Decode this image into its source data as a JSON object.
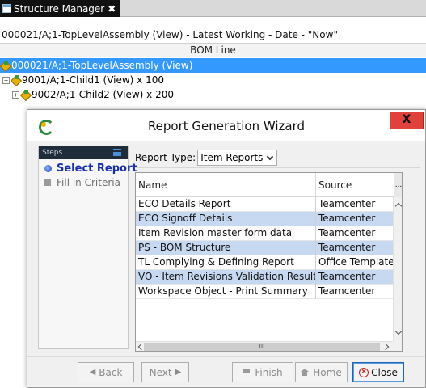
{
  "tab": {
    "title": "Structure Manager",
    "close_glyph": "✖"
  },
  "context": {
    "path": "000021/A;1-TopLevelAssembly (View) - Latest Working - Date - \"Now\""
  },
  "bom": {
    "column_header": "BOM Line",
    "rows": [
      {
        "label": "000021/A;1-TopLevelAssembly (View)",
        "expander": "",
        "selected": true
      },
      {
        "label": "9001/A;1-Child1 (View) x 100",
        "expander": "−",
        "selected": false
      },
      {
        "label": "9002/A;1-Child2 (View) x 200",
        "expander": "+",
        "selected": false
      }
    ]
  },
  "dialog": {
    "title": "Report Generation Wizard",
    "close_label": "X",
    "steps_header": "Steps",
    "steps": [
      {
        "label": "Select Report",
        "active": true
      },
      {
        "label": "Fill in Criteria",
        "active": false
      }
    ],
    "report_type": {
      "label": "Report Type:",
      "value": "Item Reports"
    },
    "table": {
      "columns": [
        "Name",
        "Source"
      ],
      "more_glyph": "...",
      "rows": [
        {
          "name": "ECO Details Report",
          "source": "Teamcenter"
        },
        {
          "name": "ECO Signoff Details",
          "source": "Teamcenter"
        },
        {
          "name": "Item Revision master form data",
          "source": "Teamcenter"
        },
        {
          "name": "PS - BOM Structure",
          "source": "Teamcenter"
        },
        {
          "name": "TL Complying & Defining Report",
          "source": "Office Template"
        },
        {
          "name": "VO - Item Revisions Validation Results",
          "source": "Teamcenter"
        },
        {
          "name": "Workspace Object - Print Summary",
          "source": "Teamcenter"
        }
      ],
      "scroll_thumb_glyph": "III"
    },
    "buttons": {
      "back": "Back",
      "next": "Next",
      "finish": "Finish",
      "home": "Home",
      "close": "Close"
    }
  },
  "colors": {
    "selection": "#3399ff",
    "row_highlight": "#c6d9f1",
    "dialog_close": "#e0413a",
    "step_active": "#1a2fb0"
  }
}
